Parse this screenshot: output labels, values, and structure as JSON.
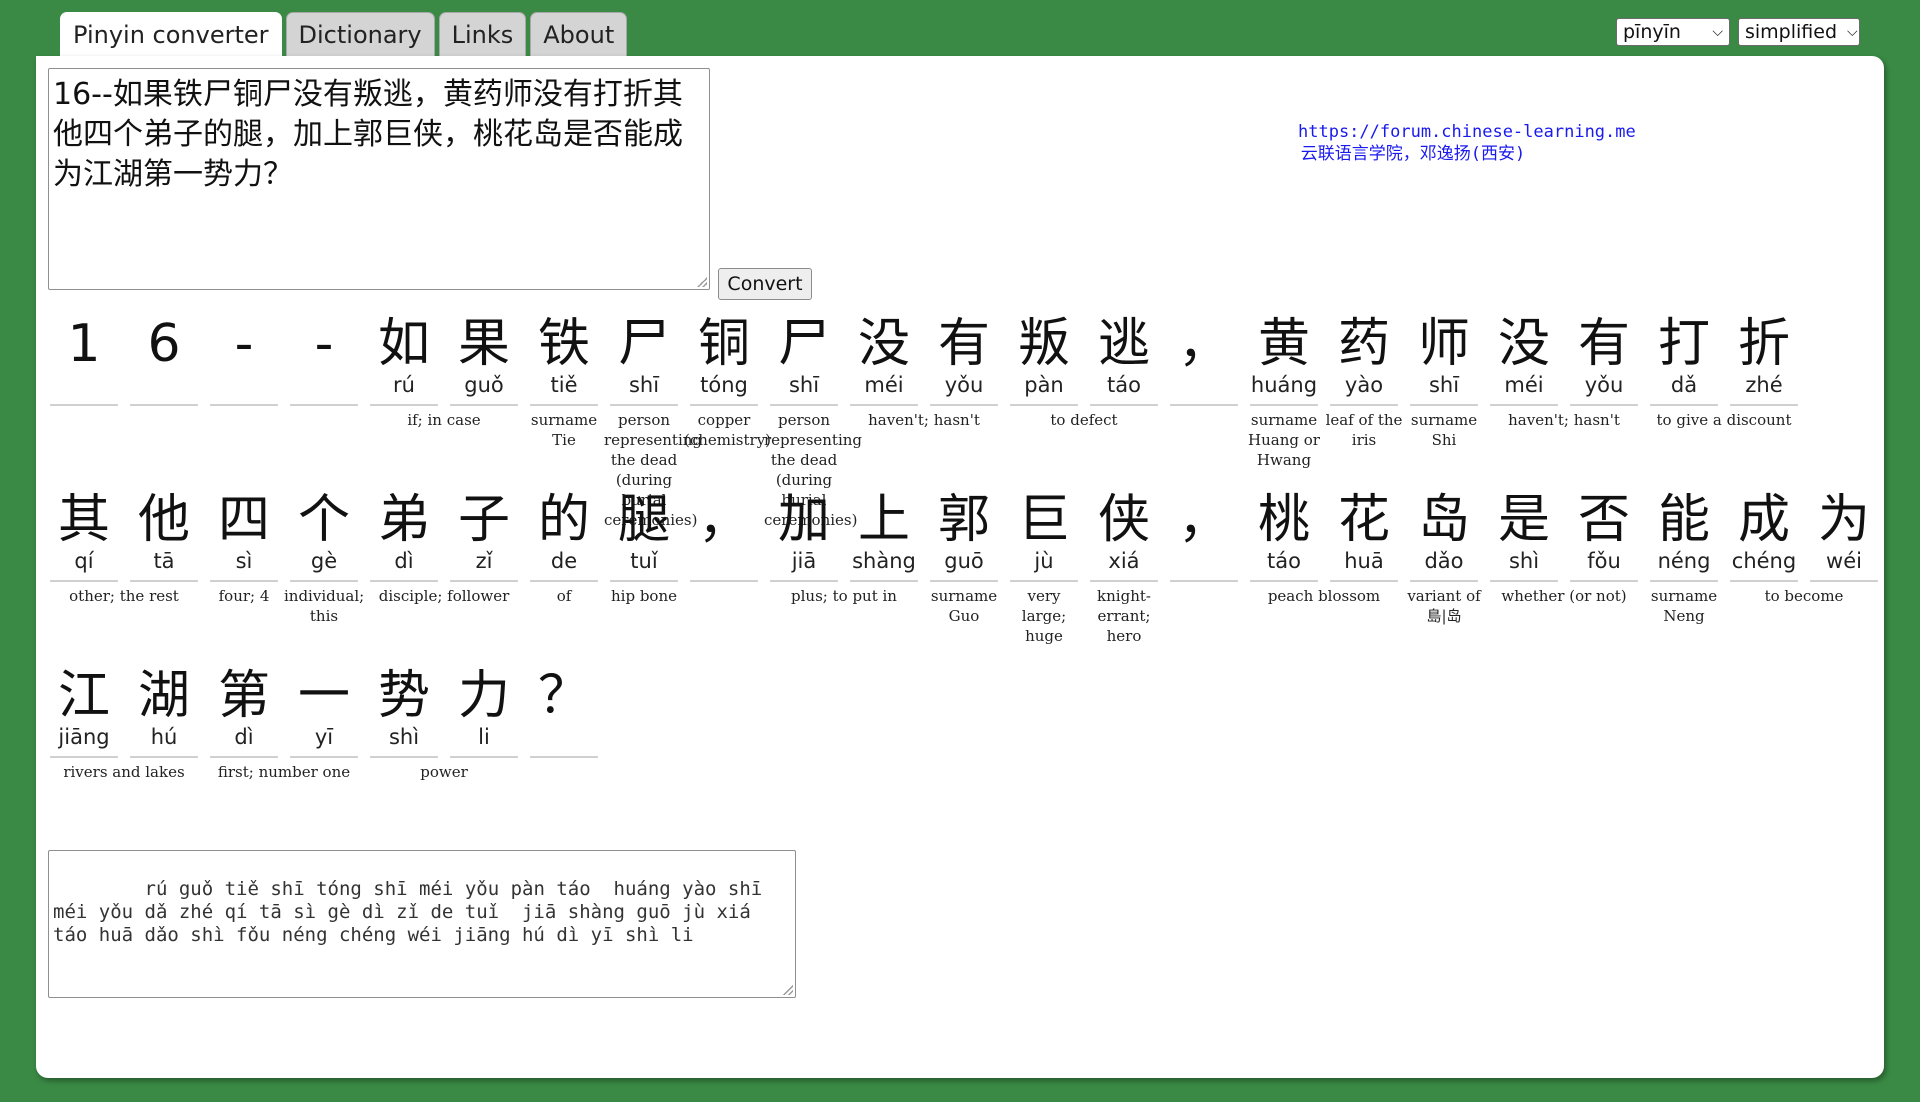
{
  "tabs": [
    {
      "label": "Pinyin converter",
      "active": true
    },
    {
      "label": "Dictionary",
      "active": false
    },
    {
      "label": "Links",
      "active": false
    },
    {
      "label": "About",
      "active": false
    }
  ],
  "selects": {
    "romanization": "pīnyīn",
    "script": "simplified"
  },
  "input_text": "16--如果铁尸铜尸没有叛逃，黄药师没有打折其他四个弟子的腿，加上郭巨侠，桃花岛是否能成为江湖第一势力？",
  "convert_label": "Convert",
  "credit": {
    "url": "https://forum.chinese-learning.me",
    "name": "云联语言学院，邓逸扬(西安)"
  },
  "rows": [
    {
      "chars": [
        {
          "hz": "1",
          "py": ""
        },
        {
          "hz": "6",
          "py": ""
        },
        {
          "hz": "-",
          "py": ""
        },
        {
          "hz": "-",
          "py": ""
        },
        {
          "hz": "如",
          "py": "rú"
        },
        {
          "hz": "果",
          "py": "guǒ"
        },
        {
          "hz": "铁",
          "py": "tiě"
        },
        {
          "hz": "尸",
          "py": "shī"
        },
        {
          "hz": "铜",
          "py": "tóng"
        },
        {
          "hz": "尸",
          "py": "shī"
        },
        {
          "hz": "没",
          "py": "méi"
        },
        {
          "hz": "有",
          "py": "yǒu"
        },
        {
          "hz": "叛",
          "py": "pàn"
        },
        {
          "hz": "逃",
          "py": "táo"
        },
        {
          "hz": "，",
          "py": ""
        },
        {
          "hz": "黄",
          "py": "huáng"
        },
        {
          "hz": "药",
          "py": "yào"
        },
        {
          "hz": "师",
          "py": "shī"
        },
        {
          "hz": "没",
          "py": "méi"
        },
        {
          "hz": "有",
          "py": "yǒu"
        },
        {
          "hz": "打",
          "py": "dǎ"
        },
        {
          "hz": "折",
          "py": "zhé"
        }
      ],
      "words": [
        {
          "start": 4,
          "span": 2,
          "def": "if; in case"
        },
        {
          "start": 6,
          "span": 1,
          "def": "surname Tie"
        },
        {
          "start": 7,
          "span": 1,
          "def": "person representing the dead (during burial ceremonies)"
        },
        {
          "start": 8,
          "span": 1,
          "def": "copper (chemistry)"
        },
        {
          "start": 9,
          "span": 1,
          "def": "person representing the dead (during burial ceremonies)"
        },
        {
          "start": 10,
          "span": 2,
          "def": "haven't; hasn't"
        },
        {
          "start": 12,
          "span": 2,
          "def": "to defect"
        },
        {
          "start": 15,
          "span": 1,
          "def": "surname Huang or Hwang"
        },
        {
          "start": 16,
          "span": 1,
          "def": "leaf of the iris"
        },
        {
          "start": 17,
          "span": 1,
          "def": "surname Shi"
        },
        {
          "start": 18,
          "span": 2,
          "def": "haven't; hasn't"
        },
        {
          "start": 20,
          "span": 2,
          "def": "to give a discount"
        }
      ]
    },
    {
      "chars": [
        {
          "hz": "其",
          "py": "qí"
        },
        {
          "hz": "他",
          "py": "tā"
        },
        {
          "hz": "四",
          "py": "sì"
        },
        {
          "hz": "个",
          "py": "gè"
        },
        {
          "hz": "弟",
          "py": "dì"
        },
        {
          "hz": "子",
          "py": "zǐ"
        },
        {
          "hz": "的",
          "py": "de"
        },
        {
          "hz": "腿",
          "py": "tuǐ"
        },
        {
          "hz": "，",
          "py": ""
        },
        {
          "hz": "加",
          "py": "jiā"
        },
        {
          "hz": "上",
          "py": "shàng"
        },
        {
          "hz": "郭",
          "py": "guō"
        },
        {
          "hz": "巨",
          "py": "jù"
        },
        {
          "hz": "侠",
          "py": "xiá"
        },
        {
          "hz": "，",
          "py": ""
        },
        {
          "hz": "桃",
          "py": "táo"
        },
        {
          "hz": "花",
          "py": "huā"
        },
        {
          "hz": "岛",
          "py": "dǎo"
        },
        {
          "hz": "是",
          "py": "shì"
        },
        {
          "hz": "否",
          "py": "fǒu"
        },
        {
          "hz": "能",
          "py": "néng"
        },
        {
          "hz": "成",
          "py": "chéng"
        },
        {
          "hz": "为",
          "py": "wéi"
        }
      ],
      "words": [
        {
          "start": 0,
          "span": 2,
          "def": "other; the rest"
        },
        {
          "start": 2,
          "span": 1,
          "def": "four; 4"
        },
        {
          "start": 3,
          "span": 1,
          "def": "individual; this"
        },
        {
          "start": 4,
          "span": 2,
          "def": "disciple; follower"
        },
        {
          "start": 6,
          "span": 1,
          "def": "of"
        },
        {
          "start": 7,
          "span": 1,
          "def": "hip bone"
        },
        {
          "start": 9,
          "span": 2,
          "def": "plus; to put in"
        },
        {
          "start": 11,
          "span": 1,
          "def": "surname Guo"
        },
        {
          "start": 12,
          "span": 1,
          "def": "very large; huge"
        },
        {
          "start": 13,
          "span": 1,
          "def": "knight-errant; hero"
        },
        {
          "start": 15,
          "span": 2,
          "def": "peach blossom"
        },
        {
          "start": 17,
          "span": 1,
          "def": "variant of 島|岛"
        },
        {
          "start": 18,
          "span": 2,
          "def": "whether (or not)"
        },
        {
          "start": 20,
          "span": 1,
          "def": "surname Neng"
        },
        {
          "start": 21,
          "span": 2,
          "def": "to become"
        }
      ]
    },
    {
      "chars": [
        {
          "hz": "江",
          "py": "jiāng"
        },
        {
          "hz": "湖",
          "py": "hú"
        },
        {
          "hz": "第",
          "py": "dì"
        },
        {
          "hz": "一",
          "py": "yī"
        },
        {
          "hz": "势",
          "py": "shì"
        },
        {
          "hz": "力",
          "py": "li"
        },
        {
          "hz": "？",
          "py": ""
        }
      ],
      "words": [
        {
          "start": 0,
          "span": 2,
          "def": "rivers and lakes"
        },
        {
          "start": 2,
          "span": 2,
          "def": "first; number one"
        },
        {
          "start": 4,
          "span": 2,
          "def": "power"
        }
      ]
    }
  ],
  "output_text": "    rú guǒ tiě shī tóng shī méi yǒu pàn táo  huáng yào shī méi yǒu dǎ zhé qí tā sì gè dì zǐ de tuǐ  jiā shàng guō jù xiá  táo huā dǎo shì fǒu néng chéng wéi jiāng hú dì yī shì li"
}
